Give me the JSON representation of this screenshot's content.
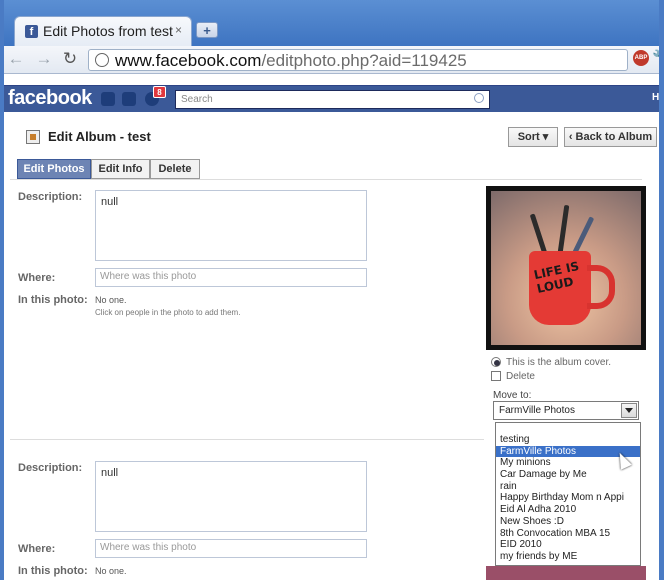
{
  "browser": {
    "tab_title": "Edit Photos from test",
    "tab_close": "×",
    "new_tab": "+",
    "url_domain": "www.facebook.com",
    "url_path": "/editphoto.php?aid=119425",
    "abp_label": "ABP"
  },
  "facebook": {
    "logo": "facebook",
    "notification_count": "8",
    "search_placeholder": "Search",
    "right_text": "H"
  },
  "page": {
    "title": "Edit Album - test",
    "sort_button": "Sort ▾",
    "back_button": "‹ Back to Album",
    "tabs": [
      "Edit Photos",
      "Edit Info",
      "Delete"
    ]
  },
  "photo1": {
    "description_label": "Description:",
    "description_value": "null",
    "where_label": "Where:",
    "where_placeholder": "Where was this photo",
    "in_photo_label": "In this photo:",
    "in_photo_value": "No one.",
    "in_photo_hint": "Click on people in the photo to add them.",
    "photo_text": "LIFE IS LOUD",
    "album_cover_label": "This is the album cover.",
    "delete_label": "Delete",
    "move_to_label": "Move to:",
    "move_to_selected": "FarmVille Photos",
    "move_to_options": [
      "testing",
      "FarmVille Photos",
      "My minions",
      "Car Damage by Me",
      "rain",
      "Happy Birthday Mom n Appi",
      "Eid Al Adha 2010",
      "New Shoes :D",
      "8th Convocation MBA 15",
      "EID 2010",
      "my friends by ME"
    ],
    "highlighted_option": "FarmVille Photos"
  },
  "photo2": {
    "description_label": "Description:",
    "description_value": "null",
    "where_label": "Where:",
    "where_placeholder": "Where was this photo",
    "in_photo_label": "In this photo:",
    "in_photo_value": "No one."
  }
}
